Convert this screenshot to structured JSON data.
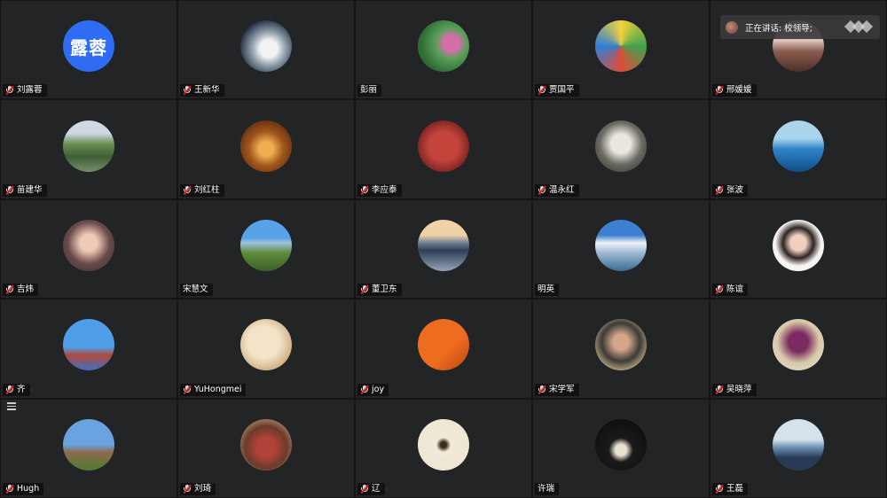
{
  "speaking": {
    "label": "正在讲话: 校领导;"
  },
  "avatar_text": "露蓉",
  "tiles": [
    {
      "name": "刘露蓉",
      "muted": true,
      "avatar": "text-avatar"
    },
    {
      "name": "王新华",
      "muted": true,
      "avatar": "feather-photo"
    },
    {
      "name": "彭丽",
      "muted": false,
      "avatar": "lotus-photo"
    },
    {
      "name": "贾国平",
      "muted": true,
      "avatar": "painting-photo"
    },
    {
      "name": "邢媛媛",
      "muted": true,
      "avatar": "portrait-photo"
    },
    {
      "name": "苗建华",
      "muted": true,
      "avatar": "landscape-photo"
    },
    {
      "name": "刘红柱",
      "muted": true,
      "avatar": "hall-photo"
    },
    {
      "name": "李应泰",
      "muted": true,
      "avatar": "trumpet-photo"
    },
    {
      "name": "温永红",
      "muted": true,
      "avatar": "cat-photo"
    },
    {
      "name": "张波",
      "muted": true,
      "avatar": "lake-birds-photo"
    },
    {
      "name": "吉炜",
      "muted": true,
      "avatar": "woman-photo"
    },
    {
      "name": "宋慧文",
      "muted": false,
      "avatar": "sky-tree-photo"
    },
    {
      "name": "董卫东",
      "muted": true,
      "avatar": "castle-photo"
    },
    {
      "name": "明英",
      "muted": false,
      "avatar": "clouds-photo"
    },
    {
      "name": "陈谊",
      "muted": true,
      "avatar": "girl-photo"
    },
    {
      "name": "齐",
      "muted": true,
      "avatar": "dancer-photo"
    },
    {
      "name": "YuHongmei",
      "muted": true,
      "avatar": "blossom-photo"
    },
    {
      "name": "joy",
      "muted": true,
      "avatar": "orange-wall-photo"
    },
    {
      "name": "宋学军",
      "muted": true,
      "avatar": "man-photo"
    },
    {
      "name": "吴晓萍",
      "muted": true,
      "avatar": "purple-hair-photo"
    },
    {
      "name": "Hugh",
      "muted": true,
      "avatar": "winter-tree-photo"
    },
    {
      "name": "刘琦",
      "muted": true,
      "avatar": "room-photo"
    },
    {
      "name": "辽",
      "muted": true,
      "avatar": "calligraphy-photo"
    },
    {
      "name": "许瑞",
      "muted": false,
      "avatar": "coffee-photo"
    },
    {
      "name": "王磊",
      "muted": true,
      "avatar": "seaside-photo"
    }
  ]
}
